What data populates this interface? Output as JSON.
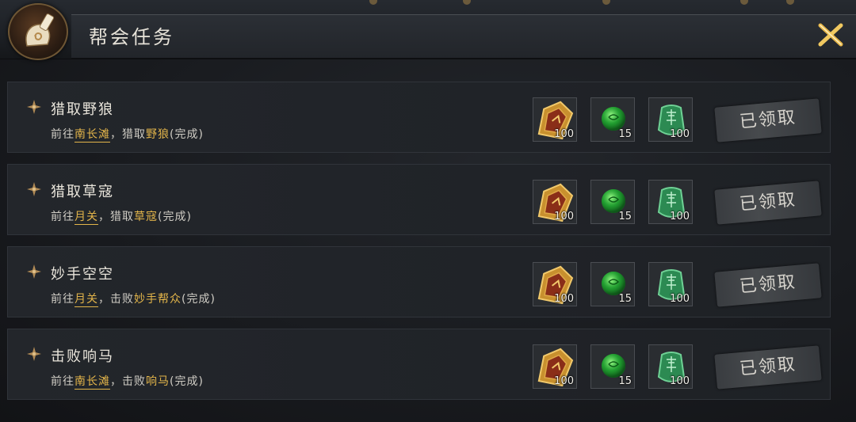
{
  "header": {
    "title": "帮会任务"
  },
  "tasks": [
    {
      "title": "猎取野狼",
      "prefix": "前往",
      "location": "南长滩",
      "sep": "，",
      "action": "猎取",
      "target": "野狼",
      "status": "(完成)",
      "rewards": [
        {
          "icon": "gold-token-icon",
          "qty": "100"
        },
        {
          "icon": "green-orb-icon",
          "qty": "15"
        },
        {
          "icon": "jade-bag-icon",
          "qty": "100"
        }
      ],
      "claim_label": "已领取"
    },
    {
      "title": "猎取草寇",
      "prefix": "前往",
      "location": "月关",
      "sep": "，",
      "action": "猎取",
      "target": "草寇",
      "status": "(完成)",
      "rewards": [
        {
          "icon": "gold-token-icon",
          "qty": "100"
        },
        {
          "icon": "green-orb-icon",
          "qty": "15"
        },
        {
          "icon": "jade-bag-icon",
          "qty": "100"
        }
      ],
      "claim_label": "已领取"
    },
    {
      "title": "妙手空空",
      "prefix": "前往",
      "location": "月关",
      "sep": "，",
      "action": "击败",
      "target": "妙手帮众",
      "status": "(完成)",
      "rewards": [
        {
          "icon": "gold-token-icon",
          "qty": "100"
        },
        {
          "icon": "green-orb-icon",
          "qty": "15"
        },
        {
          "icon": "jade-bag-icon",
          "qty": "100"
        }
      ],
      "claim_label": "已领取"
    },
    {
      "title": "击败响马",
      "prefix": "前往",
      "location": "南长滩",
      "sep": "，",
      "action": "击败",
      "target": "响马",
      "status": "(完成)",
      "rewards": [
        {
          "icon": "gold-token-icon",
          "qty": "100"
        },
        {
          "icon": "green-orb-icon",
          "qty": "15"
        },
        {
          "icon": "jade-bag-icon",
          "qty": "100"
        }
      ],
      "claim_label": "已领取"
    }
  ],
  "colors": {
    "highlight": "#e3b54a",
    "text": "#e8e4da"
  }
}
